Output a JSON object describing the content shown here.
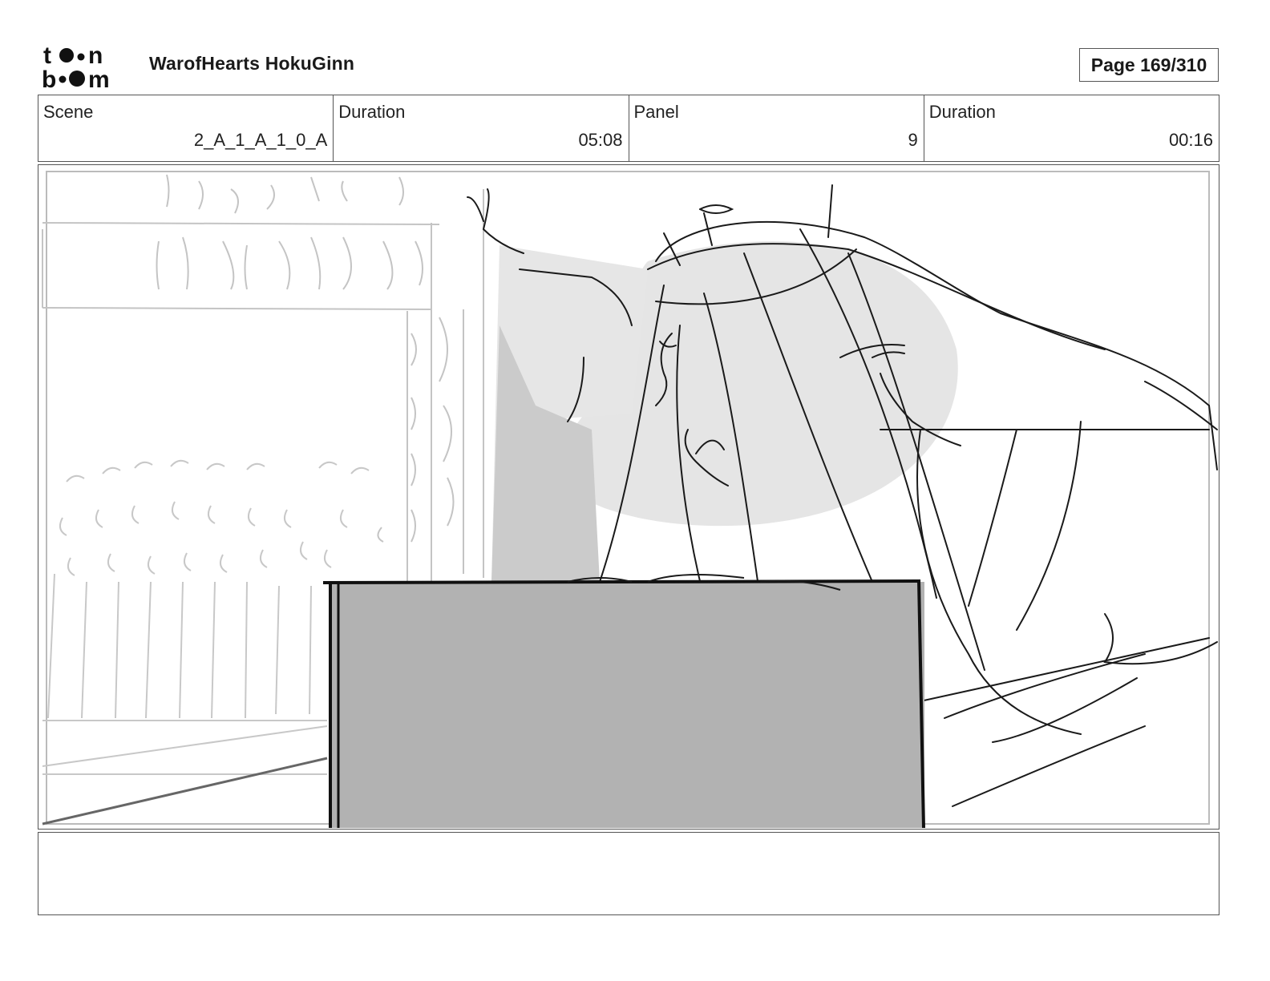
{
  "header": {
    "logo_text": "toon boom",
    "project_title": "WarofHearts HokuGinn",
    "page_label": "Page 169/310"
  },
  "info": {
    "scene_label": "Scene",
    "scene_value": "2_A_1_A_1_0_A",
    "scene_duration_label": "Duration",
    "scene_duration_value": "05:08",
    "panel_label": "Panel",
    "panel_value": "9",
    "panel_duration_label": "Duration",
    "panel_duration_value": "00:16"
  },
  "notes": {
    "text": ""
  },
  "colors": {
    "frame_border": "#555555",
    "sketch_light": "#bdbdbd",
    "sketch_dark": "#1a1a1a",
    "shade_light": "#e4e4e4",
    "shade_mid": "#cbcbcb",
    "block_fill": "#b2b2b2"
  }
}
